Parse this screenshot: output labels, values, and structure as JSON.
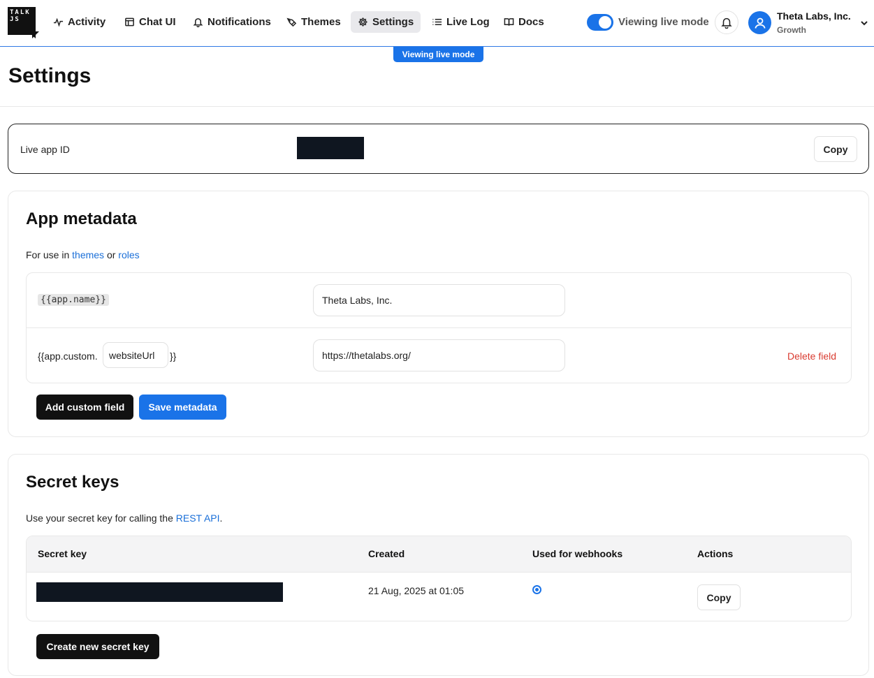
{
  "brand": {
    "logo_text": "TALK JS"
  },
  "nav": {
    "items": [
      {
        "label": "Activity",
        "icon": "activity-icon"
      },
      {
        "label": "Chat UI",
        "icon": "layout-icon"
      },
      {
        "label": "Notifications",
        "icon": "bell-icon"
      },
      {
        "label": "Themes",
        "icon": "pen-icon"
      },
      {
        "label": "Settings",
        "icon": "gear-icon",
        "active": true
      },
      {
        "label": "Live Log",
        "icon": "list-icon"
      },
      {
        "label": "Docs",
        "icon": "book-icon"
      }
    ],
    "toggle_label": "Viewing live mode",
    "toggle_on": true
  },
  "account": {
    "name": "Theta Labs, Inc.",
    "plan": "Growth"
  },
  "live_pill": "Viewing live mode",
  "page": {
    "title": "Settings"
  },
  "app_id": {
    "label": "Live app ID",
    "copy_label": "Copy"
  },
  "metadata": {
    "title": "App metadata",
    "desc_prefix": "For use in ",
    "desc_link1": "themes",
    "desc_mid": " or ",
    "desc_link2": "roles",
    "rows": [
      {
        "key": "{{app.name}}",
        "value": "Theta Labs, Inc."
      },
      {
        "key_prefix": "{{app.custom.",
        "key_name": "websiteUrl",
        "key_suffix": "}}",
        "value": "https://thetalabs.org/",
        "delete_label": "Delete field"
      }
    ],
    "add_label": "Add custom field",
    "save_label": "Save metadata"
  },
  "secret_keys": {
    "title": "Secret keys",
    "desc_prefix": "Use your secret key for calling the ",
    "desc_link": "REST API",
    "desc_suffix": ".",
    "columns": [
      "Secret key",
      "Created",
      "Used for webhooks",
      "Actions"
    ],
    "rows": [
      {
        "created": "21 Aug, 2025 at 01:05",
        "webhooks": true,
        "action_label": "Copy"
      }
    ],
    "create_label": "Create new secret key"
  },
  "colors": {
    "accent": "#1a73e8",
    "danger": "#d93b30",
    "dark": "#111111"
  }
}
